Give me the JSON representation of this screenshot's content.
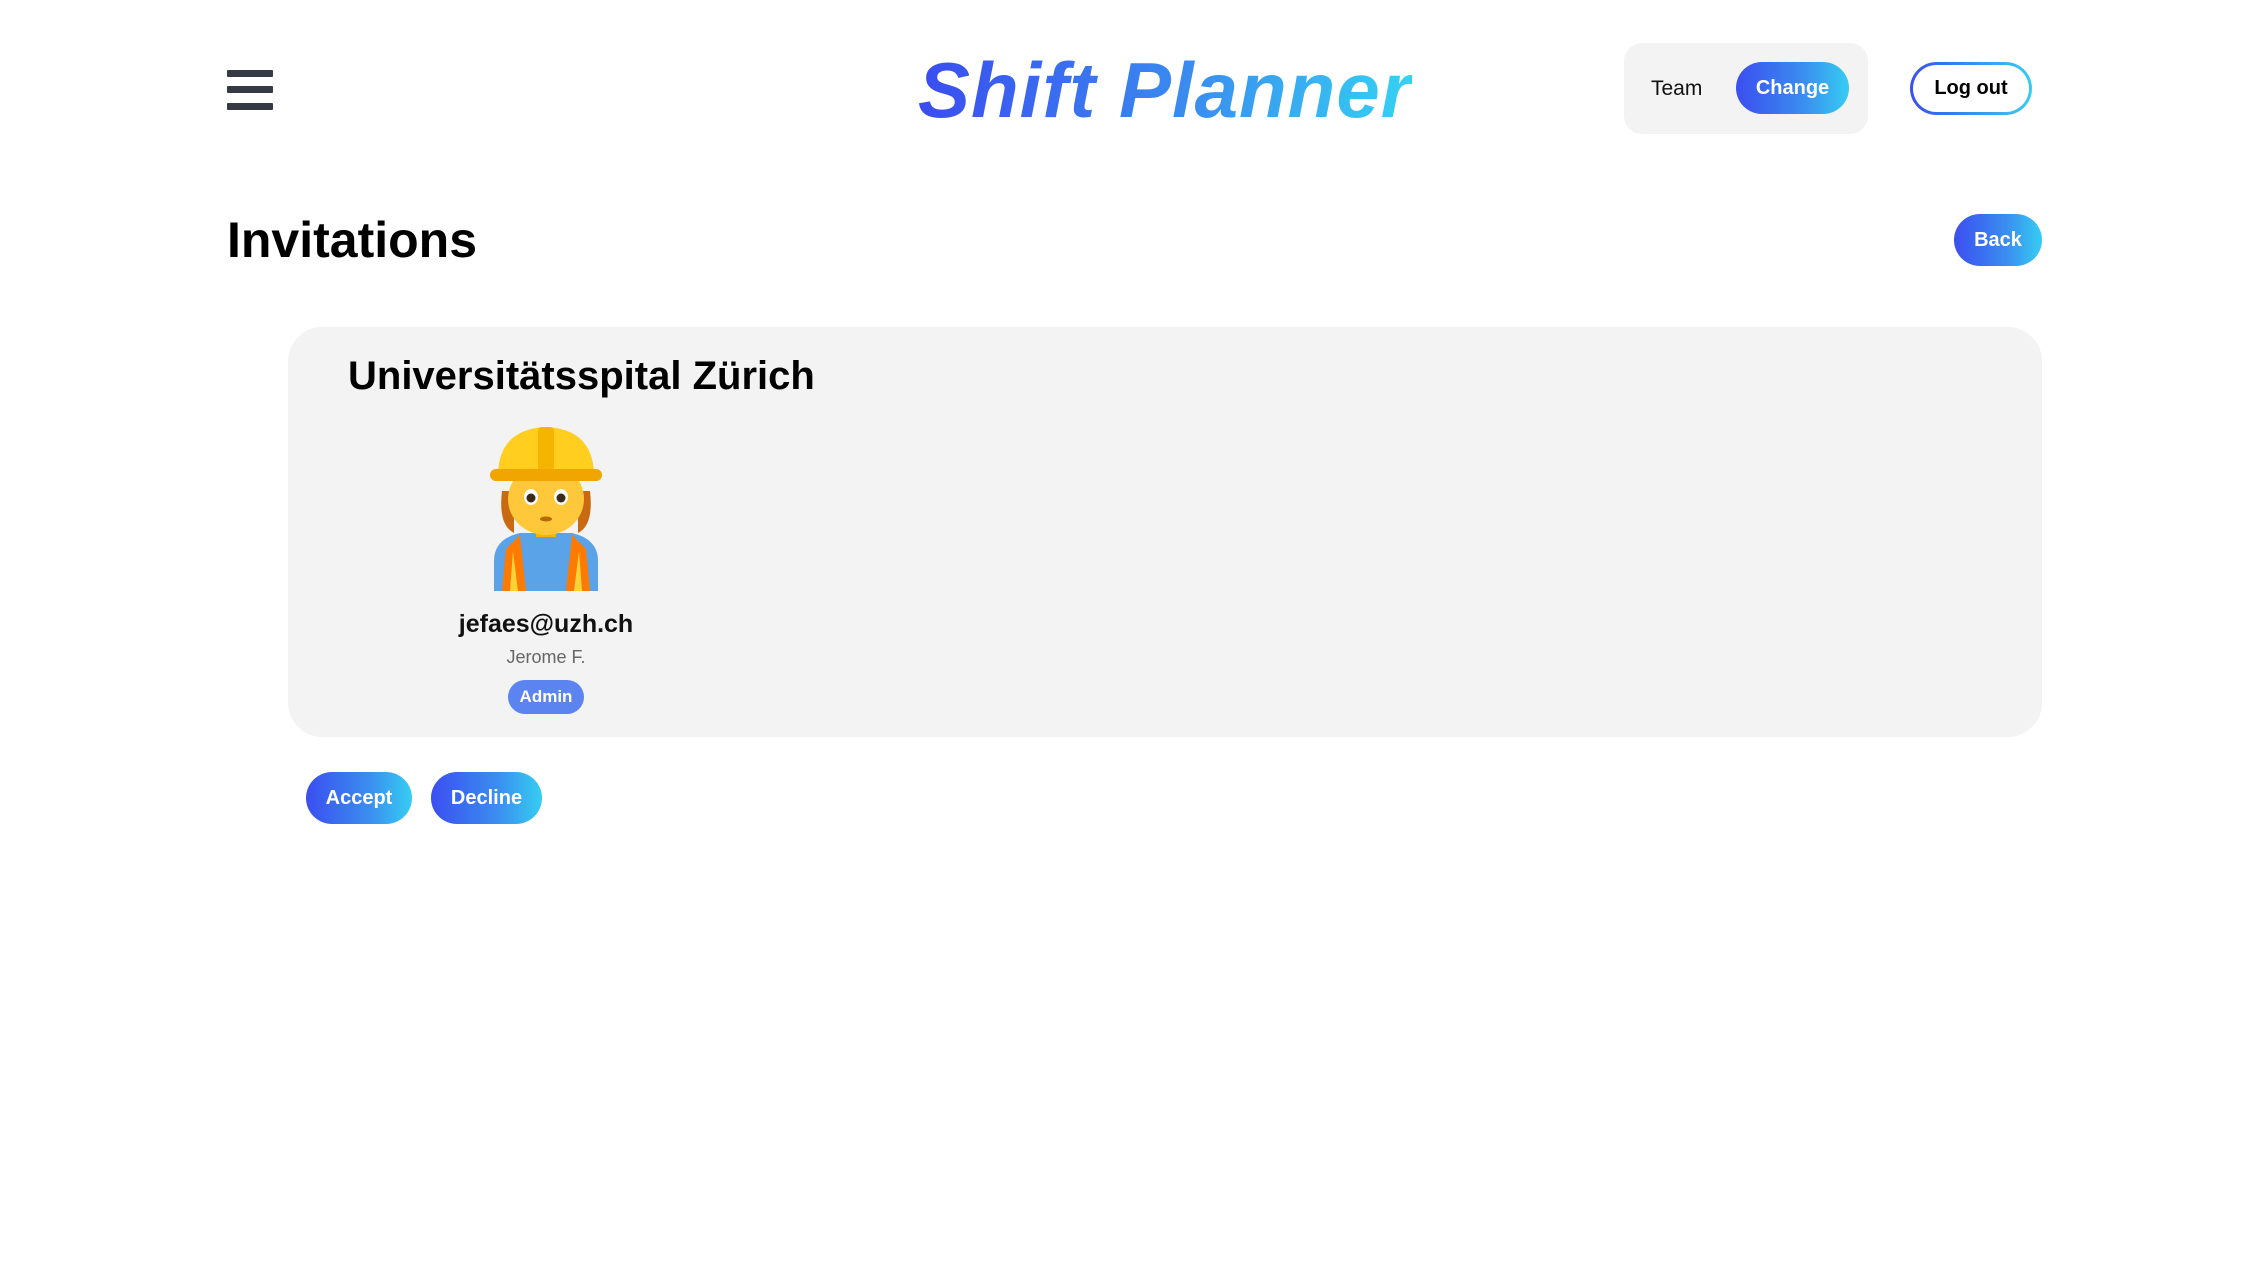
{
  "header": {
    "brand": "Shift Planner",
    "team_label": "Team",
    "change_label": "Change",
    "logout_label": "Log out",
    "menu_icon": "hamburger-menu-icon"
  },
  "page": {
    "title": "Invitations",
    "back_label": "Back"
  },
  "invitation": {
    "organization": "Universitätsspital Zürich",
    "members": [
      {
        "avatar": "construction-worker-emoji",
        "email": "jefaes@uzh.ch",
        "name": "Jerome F.",
        "role": "Admin"
      }
    ],
    "accept_label": "Accept",
    "decline_label": "Decline"
  },
  "colors": {
    "gradient_start": "#3b4ef0",
    "gradient_end": "#36cdf2",
    "card_background": "#f3f3f3",
    "role_badge": "#5b84f0"
  }
}
